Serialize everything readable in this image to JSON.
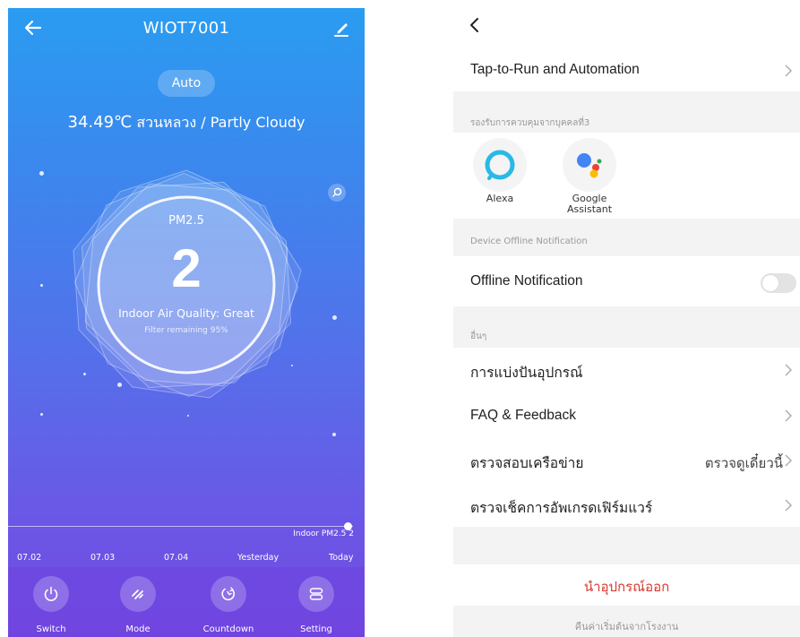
{
  "device": {
    "title": "WIOT7001",
    "mode_pill": "Auto",
    "weather_temp": "34.49℃",
    "weather_text": "สวนหลวง / Partly Cloudy",
    "pm_label": "PM2.5",
    "pm_value": "2",
    "air_quality": "Indoor Air Quality: Great",
    "filter": "Filter remaining 95%",
    "trend_label": "Indoor PM2.5 2",
    "dates": [
      "07.02",
      "07.03",
      "07.04",
      "Yesterday",
      "Today"
    ],
    "controls": [
      {
        "label": "Switch",
        "icon": "power-icon"
      },
      {
        "label": "Mode",
        "icon": "mode-icon"
      },
      {
        "label": "Countdown",
        "icon": "countdown-icon"
      },
      {
        "label": "Setting",
        "icon": "settings-icon"
      }
    ],
    "colors": {
      "gradient_top": "#2a9cf1",
      "gradient_bottom": "#7349e2"
    }
  },
  "settings": {
    "tap_to_run": "Tap-to-Run and Automation",
    "third_party_section": "รองรับการควบคุมจากบุคคลที่3",
    "assistants": [
      {
        "name": "Alexa",
        "icon": "alexa-icon"
      },
      {
        "name": "Google Assistant",
        "icon": "google-assistant-icon"
      }
    ],
    "offline_section": "Device Offline Notification",
    "offline_label": "Offline Notification",
    "offline_enabled": false,
    "other_section": "อื่นๆ",
    "share": "การแบ่งปันอุปกรณ์",
    "faq": "FAQ & Feedback",
    "network": "ตรวจสอบเครือข่าย",
    "network_value": "ตรวจดูเดี๋ยวนี้",
    "firmware": "ตรวจเช็คการอัพเกรดเฟิร์มแวร์",
    "remove": "นำอุปกรณ์ออก",
    "reset": "คืนค่าเริ่มต้นจากโรงงาน",
    "colors": {
      "remove": "#d6392f",
      "section_bg": "#f3f3f4"
    }
  }
}
